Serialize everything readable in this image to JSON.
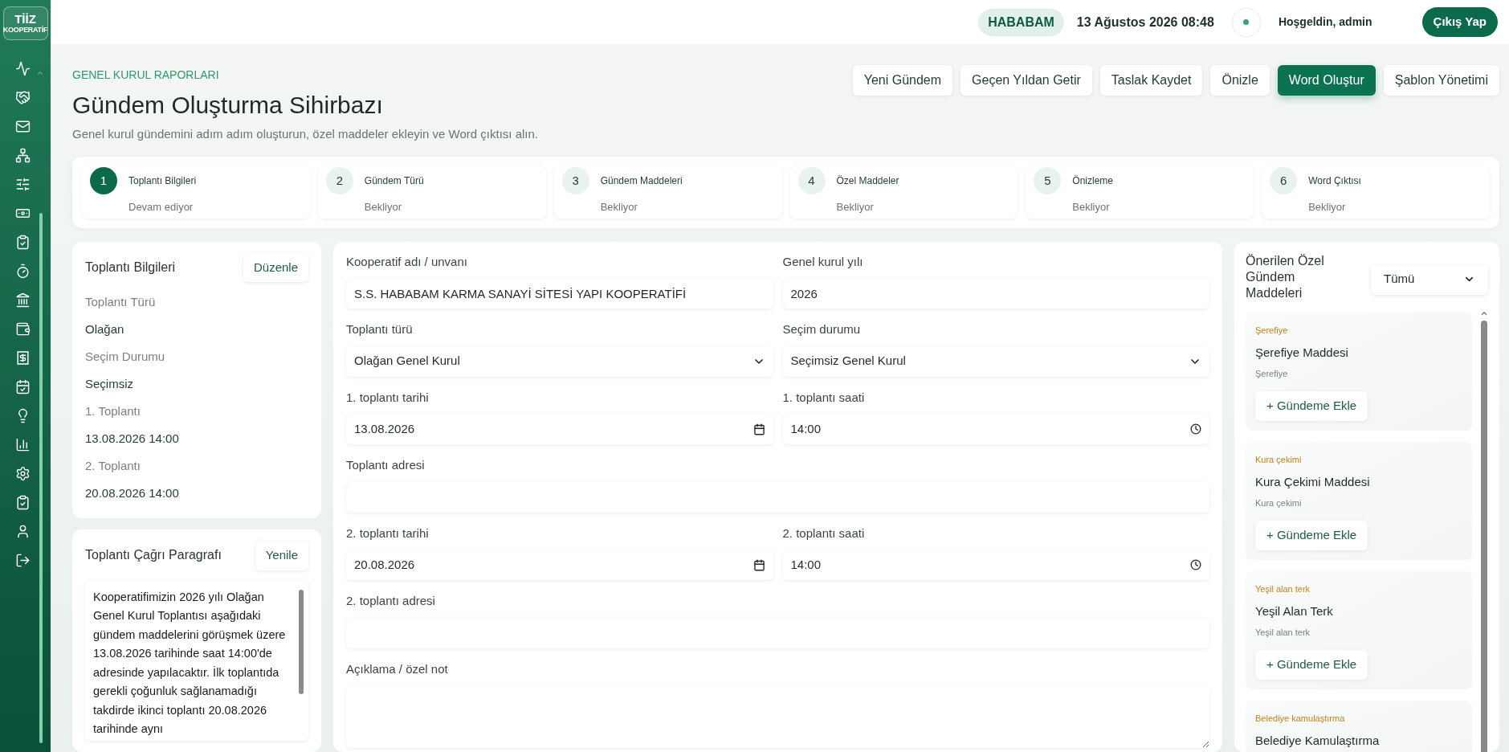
{
  "logo": {
    "title": "TİİZ",
    "subtitle": "KOOPERATİF"
  },
  "topbar": {
    "badge": "HABABAM",
    "datetime": "13 Ağustos 2026 08:48",
    "greeting": "Hoşgeldin, admin",
    "logout": "Çıkış Yap"
  },
  "header": {
    "eyebrow": "GENEL KURUL RAPORLARI",
    "title": "Gündem Oluşturma Sihirbazı",
    "description": "Genel kurul gündemini adım adım oluşturun, özel maddeler ekleyin ve Word çıktısı alın.",
    "actions": [
      {
        "label": "Yeni Gündem",
        "primary": false
      },
      {
        "label": "Geçen Yıldan Getir",
        "primary": false
      },
      {
        "label": "Taslak Kaydet",
        "primary": false
      },
      {
        "label": "Önizle",
        "primary": false
      },
      {
        "label": "Word Oluştur",
        "primary": true
      },
      {
        "label": "Şablon Yönetimi",
        "primary": false
      }
    ]
  },
  "steps": [
    {
      "number": "1",
      "title": "Toplantı Bilgileri",
      "status": "Devam ediyor",
      "selected": true
    },
    {
      "number": "2",
      "title": "Gündem Türü",
      "status": "Bekliyor",
      "selected": false
    },
    {
      "number": "3",
      "title": "Gündem Maddeleri",
      "status": "Bekliyor",
      "selected": false
    },
    {
      "number": "4",
      "title": "Özel Maddeler",
      "status": "Bekliyor",
      "selected": false
    },
    {
      "number": "5",
      "title": "Önizleme",
      "status": "Bekliyor",
      "selected": false
    },
    {
      "number": "6",
      "title": "Word Çıktısı",
      "status": "Bekliyor",
      "selected": false
    }
  ],
  "summary": {
    "title": "Toplantı Bilgileri",
    "button": "Düzenle",
    "items": [
      {
        "label": "Toplantı Türü",
        "value": "Olağan"
      },
      {
        "label": "Seçim Durumu",
        "value": "Seçimsiz"
      },
      {
        "label": "1. Toplantı",
        "value": "13.08.2026 14:00"
      },
      {
        "label": "2. Toplantı",
        "value": "20.08.2026 14:00"
      }
    ]
  },
  "call_paragraph": {
    "title": "Toplantı Çağrı Paragrafı",
    "button": "Yenile",
    "text": "Kooperatifimizin 2026 yılı Olağan Genel Kurul Toplantısı aşağıdaki gündem maddelerini görüşmek üzere 13.08.2026 tarihinde saat 14:00'de  adresinde yapılacaktır. İlk toplantıda gerekli çoğunluk sağlanamadığı takdirde ikinci toplantı 20.08.2026 tarihinde aynı"
  },
  "form_rows": [
    [
      {
        "kind": "text",
        "label": "Kooperatif adı / unvanı",
        "value": "S.S. HABABAM KARMA SANAYİ SİTESİ YAPI KOOPERATİFİ"
      },
      {
        "kind": "text",
        "label": "Genel kurul yılı",
        "value": "2026"
      }
    ],
    [
      {
        "kind": "select",
        "label": "Toplantı türü",
        "value": "Olağan Genel Kurul"
      },
      {
        "kind": "select",
        "label": "Seçim durumu",
        "value": "Seçimsiz Genel Kurul"
      }
    ],
    [
      {
        "kind": "date",
        "label": "1. toplantı tarihi",
        "value": "13.08.2026"
      },
      {
        "kind": "time",
        "label": "1. toplantı saati",
        "value": "14:00"
      }
    ],
    [
      {
        "kind": "text",
        "label": "Toplantı adresi"
      }
    ],
    [
      {
        "kind": "date",
        "label": "2. toplantı tarihi",
        "value": "20.08.2026"
      },
      {
        "kind": "time",
        "label": "2. toplantı saati",
        "value": "14:00"
      }
    ],
    [
      {
        "kind": "text",
        "label": "2. toplantı adresi"
      }
    ],
    [
      {
        "kind": "textarea",
        "label": "Açıklama / özel not"
      }
    ]
  ],
  "suggestions": {
    "title": "Önerilen Özel Gündem Maddeleri",
    "filter": "Tümü",
    "items": [
      {
        "category": "Şerefiye",
        "title": "Şerefiye Maddesi",
        "subtitle": "Şerefiye",
        "button": "+ Gündeme Ekle"
      },
      {
        "category": "Kura çekimi",
        "title": "Kura Çekimi Maddesi",
        "subtitle": "Kura çekimi",
        "button": "+ Gündeme Ekle"
      },
      {
        "category": "Yeşil alan terk",
        "title": "Yeşil Alan Terk",
        "subtitle": "Yeşil alan terk",
        "button": "+ Gündeme Ekle"
      },
      {
        "category": "Belediye kamulaştırma",
        "title": "Belediye Kamulaştırma"
      }
    ]
  }
}
